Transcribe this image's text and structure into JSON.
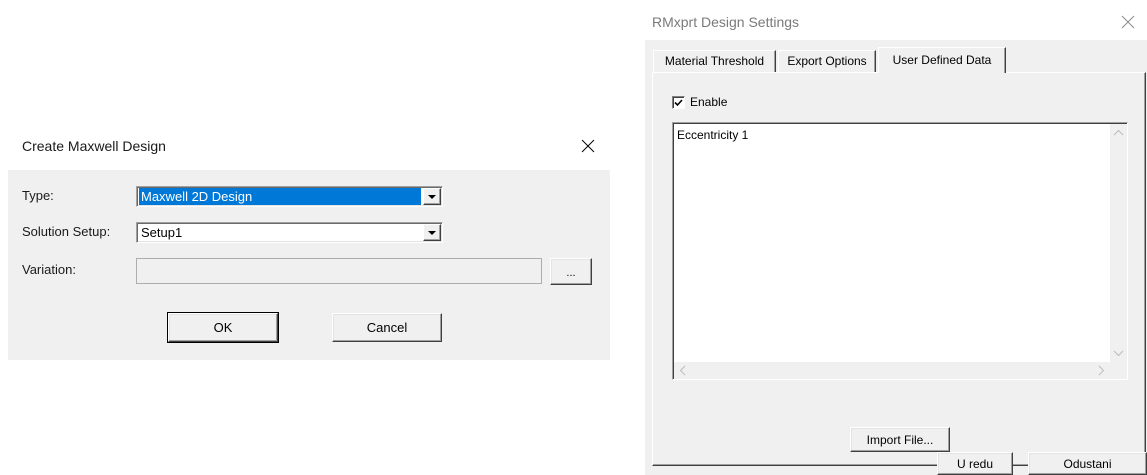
{
  "colors": {
    "dialog_bg": "#f0f0f0",
    "selection": "#0078d7"
  },
  "icons": {
    "close": "close-icon",
    "dropdown": "chevron-down-icon",
    "checkbox": "check-icon"
  },
  "create_dialog": {
    "title": "Create Maxwell Design",
    "type": {
      "label": "Type:",
      "value": "Maxwell 2D Design"
    },
    "solution_setup": {
      "label": "Solution Setup:",
      "value": "Setup1"
    },
    "variation": {
      "label": "Variation:",
      "value": "",
      "browse_label": "..."
    },
    "ok_label": "OK",
    "cancel_label": "Cancel"
  },
  "settings_dialog": {
    "title": "RMxprt Design Settings",
    "tabs": [
      {
        "label": "Material Threshold",
        "active": false
      },
      {
        "label": "Export Options",
        "active": false
      },
      {
        "label": "User Defined Data",
        "active": true
      }
    ],
    "enable": {
      "label": "Enable",
      "checked": true
    },
    "user_data_text": "Eccentricity 1",
    "import_label": "Import File...",
    "ok_label": "U redu",
    "cancel_label": "Odustani"
  }
}
